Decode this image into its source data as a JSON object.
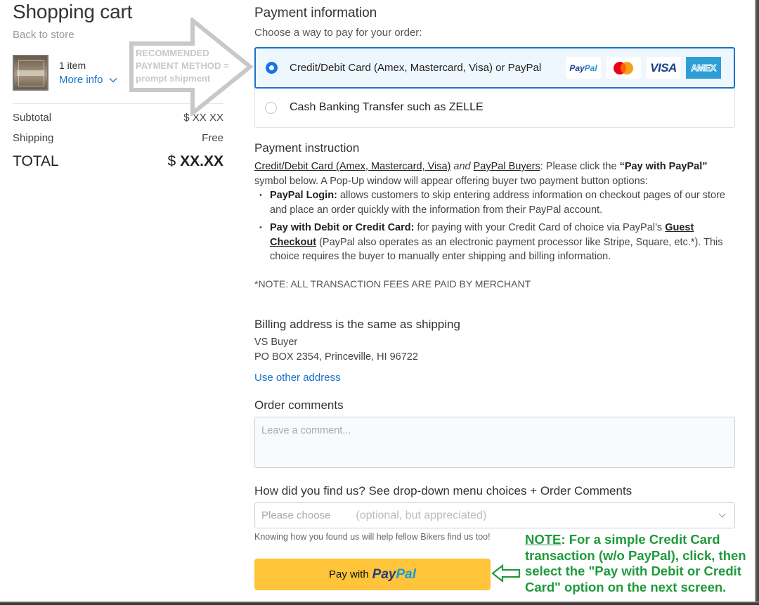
{
  "cart": {
    "title": "Shopping cart",
    "back_link": "Back to store",
    "item_count": "1 item",
    "more_info": "More info",
    "subtotal_label": "Subtotal",
    "subtotal_value": "$ XX XX",
    "shipping_label": "Shipping",
    "shipping_value": "Free",
    "total_label": "TOTAL",
    "total_currency": "$",
    "total_value": "XX.XX"
  },
  "annotation": {
    "recommended_line1": "RECOMMENDED",
    "recommended_line2": "PAYMENT METHOD =",
    "recommended_line3": "prompt shipment",
    "note_label": "NOTE",
    "note_text": ": For a simple Credit Card transaction (w/o PayPal), click, then select the \"Pay with Debit or Credit Card\" option on the next screen.",
    "colors": {
      "recommended": "#c8c8c8",
      "note": "#1f9a3a"
    }
  },
  "payment": {
    "title": "Payment information",
    "subtitle": "Choose a way to pay for your order:",
    "options": [
      {
        "label": "Credit/Debit Card (Amex, Mastercard, Visa) or PayPal",
        "selected": true
      },
      {
        "label": "Cash Banking Transfer such as ZELLE",
        "selected": false
      }
    ],
    "logos": {
      "paypal_a": "Pay",
      "paypal_b": "Pal",
      "mastercard": "mastercard-logo",
      "visa": "VISA",
      "amex": "AMEX"
    },
    "accent": "#1a73c8"
  },
  "instruction": {
    "title": "Payment instruction",
    "intro_link1": "Credit/Debit Card (Amex, Mastercard, Visa)",
    "intro_and": "and",
    "intro_link2": "PayPal Buyers",
    "intro_mid": ": Please click the ",
    "intro_quote": "“Pay with PayPal”",
    "intro_end": " symbol below. A Pop-Up window will appear offering buyer two payment button options:",
    "bullets": [
      {
        "bold": "PayPal Login:",
        "text": " allows customers to skip entering address information on checkout pages of our store and place an order quickly with the information from their PayPal account."
      },
      {
        "bold": "Pay with Debit or Credit Card:",
        "text": " for paying with your Credit Card of choice via PayPal’s ",
        "link": "Guest Checkout",
        "text2": " (PayPal also operates as an electronic payment processor like Stripe, Square, etc.*). This choice requires the buyer to manually enter shipping and billing information."
      }
    ],
    "fee_note": "*NOTE: ALL TRANSACTION FEES ARE PAID BY MERCHANT"
  },
  "billing": {
    "title": "Billing address is the same as shipping",
    "name": "VS Buyer",
    "address": "PO BOX 2354, Princeville, HI 96722",
    "other_link": "Use other address"
  },
  "comments": {
    "title": "Order comments",
    "placeholder": "Leave a comment...",
    "value": ""
  },
  "find_us": {
    "title": "How did you find us? See drop-down menu choices + Order Comments",
    "selected": "Please choose",
    "hint": "(optional, but appreciated)",
    "help": "Knowing how you found us will help fellow Bikers find us too!"
  },
  "paypal_button": {
    "prefix": "Pay with",
    "brand_a": "Pay",
    "brand_b": "Pal",
    "color": "#ffc439"
  }
}
